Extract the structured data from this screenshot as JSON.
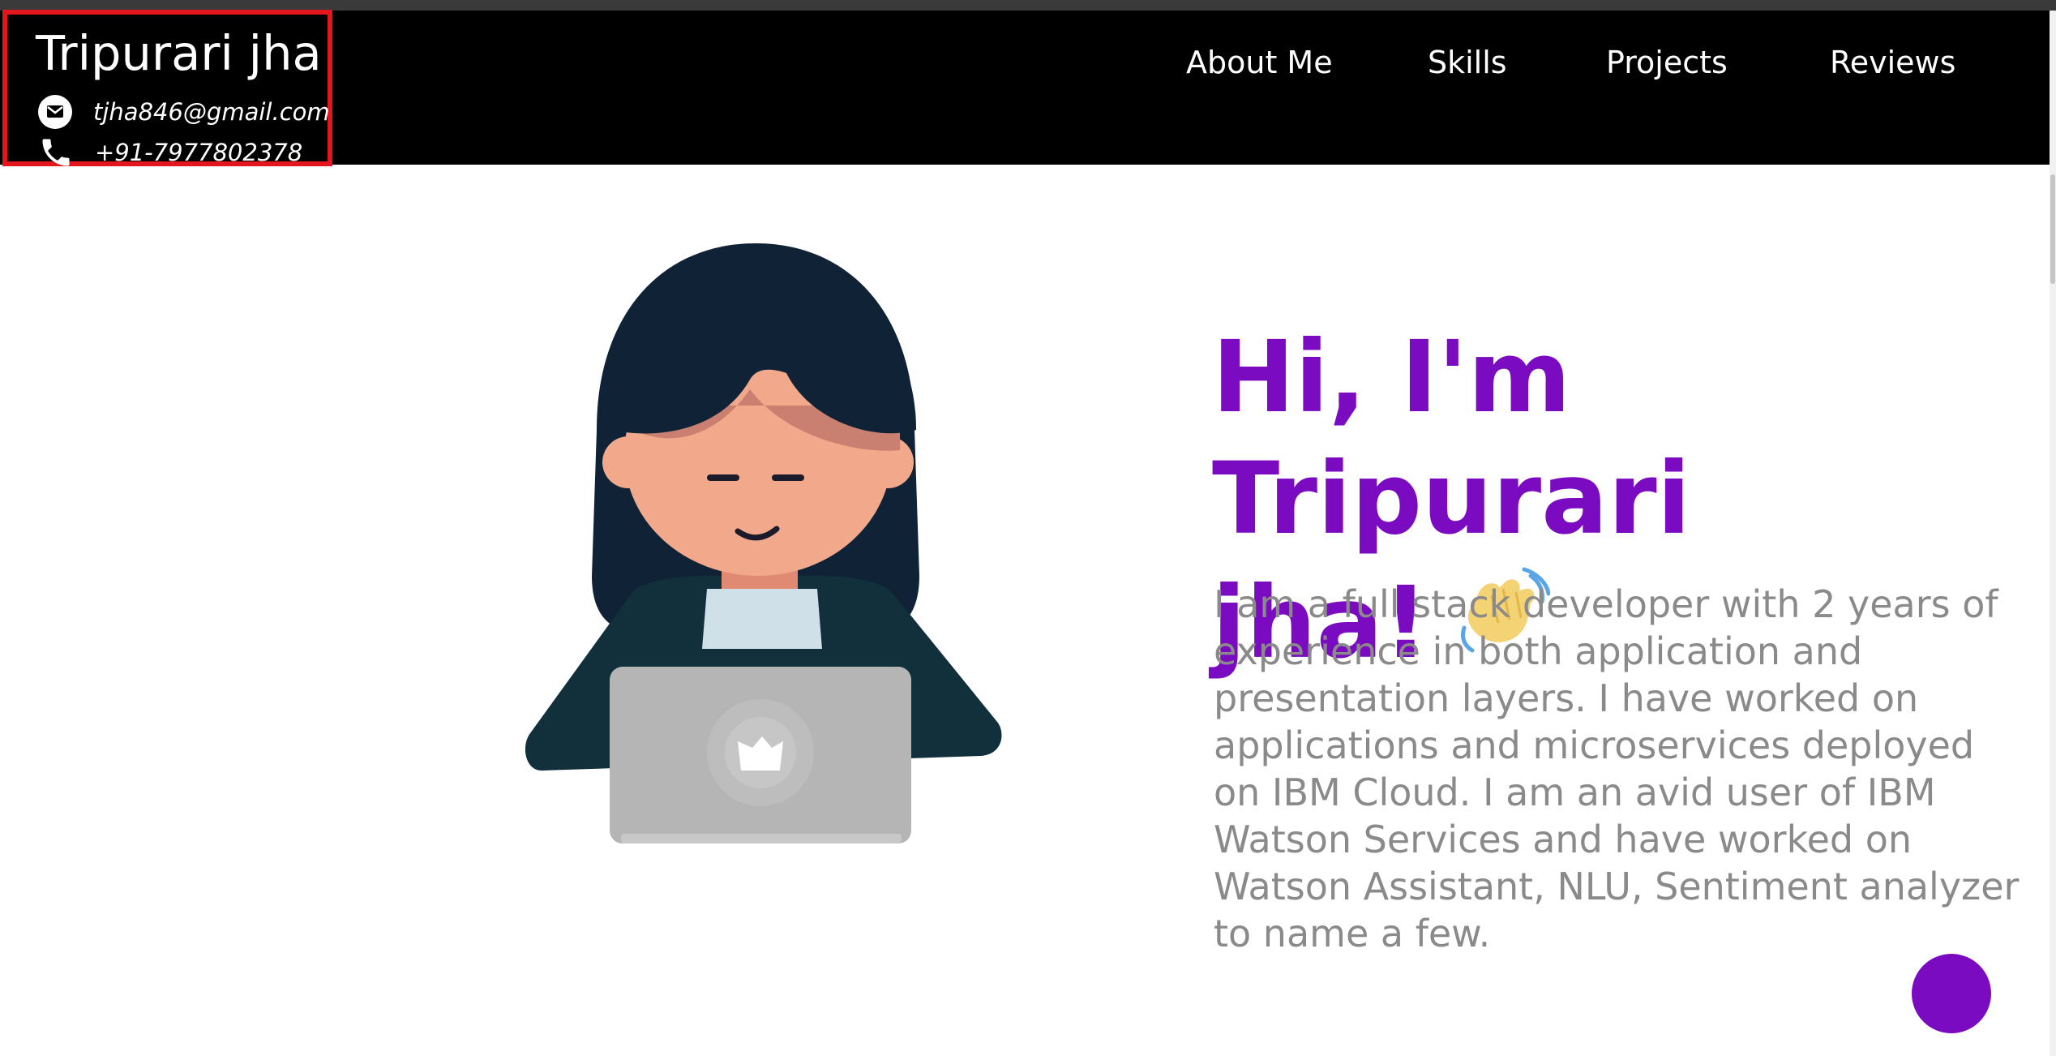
{
  "header": {
    "name": "Tripurari jha",
    "email": "tjha846@gmail.com",
    "phone": "+91-7977802378",
    "email_icon": "mail-icon",
    "phone_icon": "phone-icon"
  },
  "nav": {
    "items": [
      {
        "label": "About Me"
      },
      {
        "label": "Skills"
      },
      {
        "label": "Projects"
      },
      {
        "label": "Reviews"
      }
    ]
  },
  "hero": {
    "title": "Hi, I'm Tripurari jha!",
    "title_line1": "Hi, I'm Tripurari",
    "title_line2": "jha!",
    "wave_icon": "waving-hand-icon",
    "description": "I am a full stack developer with 2 years of experience in both application and presentation layers. I have worked on applications and microservices deployed on IBM Cloud. I am an avid user of IBM Watson Services and have worked on Watson Assistant, NLU, Sentiment analyzer to name a few.",
    "illustration": "developer-with-laptop-illustration"
  },
  "colors": {
    "accent": "#7a0bc0",
    "navbar": "#000000",
    "highlight_border": "#e3161d",
    "description_text": "#8a8a8a"
  }
}
